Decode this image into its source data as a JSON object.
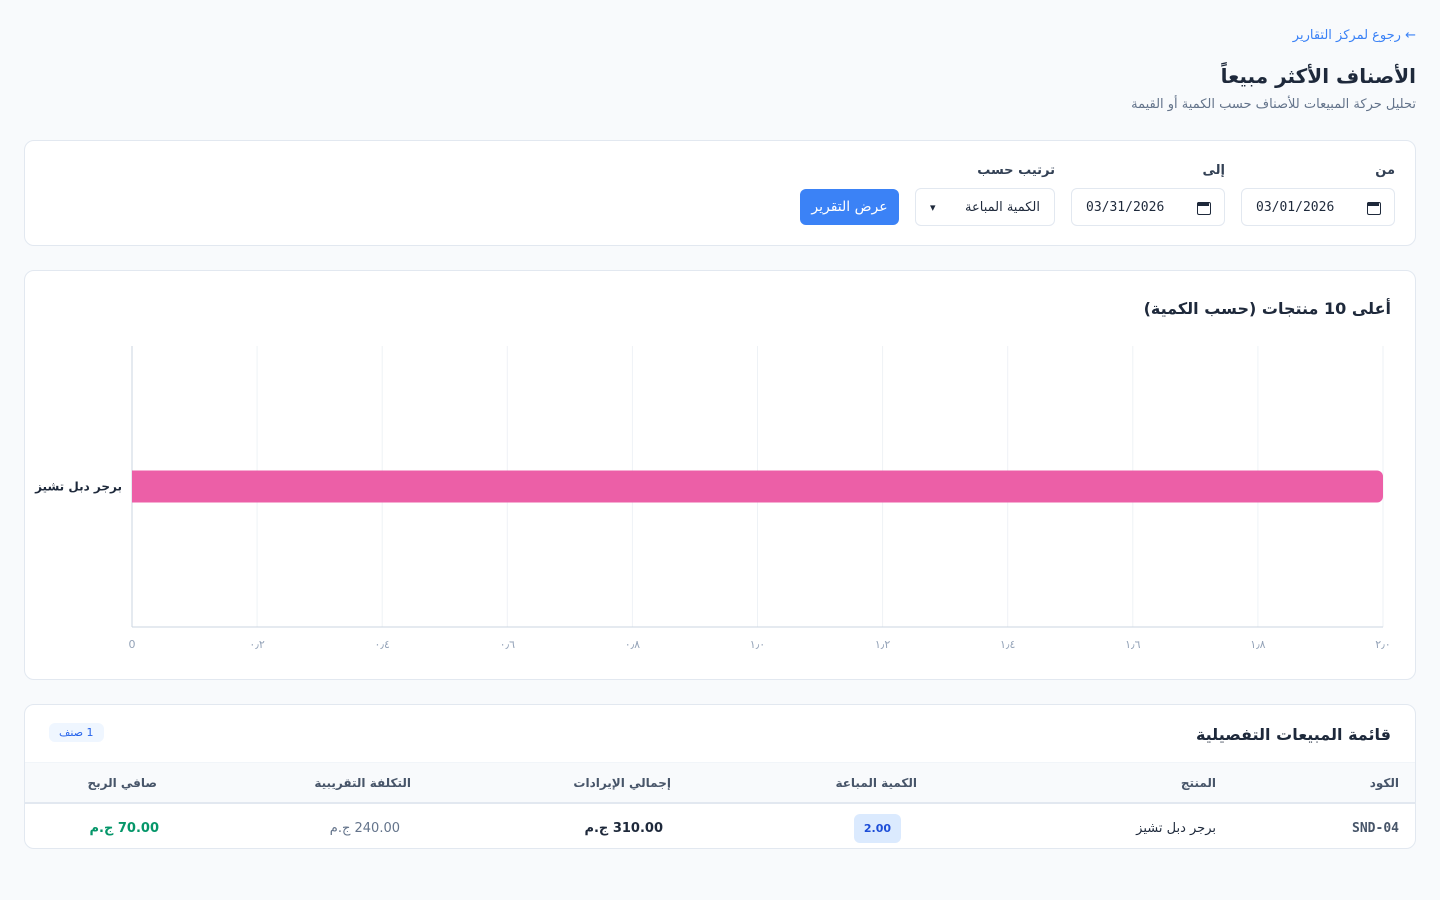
{
  "nav": {
    "back_link": "← رجوع لمركز التقارير"
  },
  "header": {
    "title": "الأصناف الأكثر مبيعاً",
    "subtitle": "تحليل حركة المبيعات للأصناف حسب الكمية أو القيمة"
  },
  "filters": {
    "from_label": "من",
    "from_value": "03/01/2026",
    "to_label": "إلى",
    "to_value": "03/31/2026",
    "sort_label": "ترتيب حسب",
    "sort_value": "الكمية المباعة",
    "submit_label": "عرض التقرير"
  },
  "chart": {
    "title": "أعلى 10 منتجات (حسب الكمية)"
  },
  "chart_data": {
    "type": "bar",
    "orientation": "horizontal",
    "title": "أعلى 10 منتجات (حسب الكمية)",
    "categories": [
      "برجر دبل تشيز"
    ],
    "values": [
      2
    ],
    "xlim": [
      0,
      2
    ],
    "x_ticks": [
      "0",
      "٠٫٢",
      "٠٫٤",
      "٠٫٦",
      "٠٫٨",
      "١٫٠",
      "١٫٢",
      "١٫٤",
      "١٫٦",
      "١٫٨",
      "٢٫٠"
    ],
    "bar_color": "#ec5fa7",
    "grid": true
  },
  "table": {
    "title": "قائمة المبيعات التفصيلية",
    "count_badge": "1 صنف",
    "headers": {
      "code": "الكود",
      "product": "المنتج",
      "qty": "الكمية المباعة",
      "revenue": "إجمالي الإيرادات",
      "cost": "التكلفة التقريبية",
      "profit": "صافي الربح"
    },
    "rows": [
      {
        "code": "SND-04",
        "product": "برجر دبل تشيز",
        "qty": "2.00",
        "revenue": "310.00 ج.م",
        "cost": "240.00 ج.م",
        "profit": "70.00 ج.م"
      }
    ]
  },
  "colors": {
    "accent": "#3b82f6",
    "bar": "#ec5fa7",
    "profit": "#059669"
  }
}
